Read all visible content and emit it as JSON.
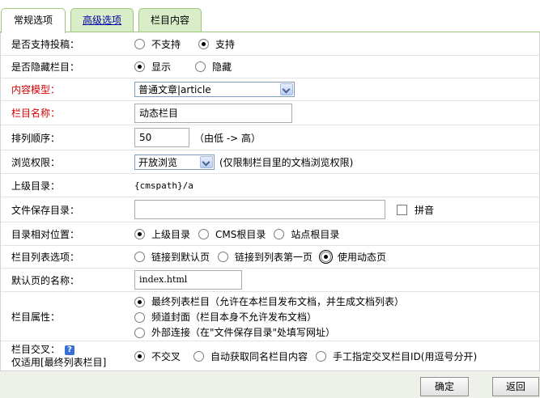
{
  "tabs": [
    "常规选项",
    "高级选项",
    "栏目内容"
  ],
  "rows": {
    "contribute": {
      "label": "是否支持投稿：",
      "options": [
        "不支持",
        "支持"
      ]
    },
    "hidden": {
      "label": "是否隐藏栏目：",
      "options": [
        "显示",
        "隐藏"
      ]
    },
    "model": {
      "label": "内容模型：",
      "value": "普通文章|article"
    },
    "name": {
      "label": "栏目名称：",
      "value": "动态栏目"
    },
    "order": {
      "label": "排列顺序：",
      "value": "50",
      "hint": "（由低 -> 高）"
    },
    "perm": {
      "label": "浏览权限：",
      "value": "开放浏览",
      "hint": "(仅限制栏目里的文档浏览权限)"
    },
    "parent": {
      "label": "上级目录：",
      "value": "{cmspath}/a"
    },
    "savedir": {
      "label": "文件保存目录：",
      "value": "",
      "pinyin": "拼音"
    },
    "relpos": {
      "label": "目录相对位置：",
      "options": [
        "上级目录",
        "CMS根目录",
        "站点根目录"
      ]
    },
    "listopt": {
      "label": "栏目列表选项：",
      "options": [
        "链接到默认页",
        "链接到列表第一页",
        "使用动态页"
      ]
    },
    "defpage": {
      "label": "默认页的名称：",
      "value": "index.html"
    },
    "attr": {
      "label": "栏目属性：",
      "options": [
        "最终列表栏目（允许在本栏目发布文档，并生成文档列表）",
        "频道封面（栏目本身不允许发布文档）",
        "外部连接（在\"文件保存目录\"处填写网址）"
      ]
    },
    "cross": {
      "label1": "栏目交叉：",
      "label2": "仅适用[最终列表栏目]",
      "options": [
        "不交叉",
        "自动获取同名栏目内容",
        "手工指定交叉栏目ID(用逗号分开)"
      ]
    }
  },
  "buttons": {
    "ok": "确定",
    "back": "返回"
  }
}
